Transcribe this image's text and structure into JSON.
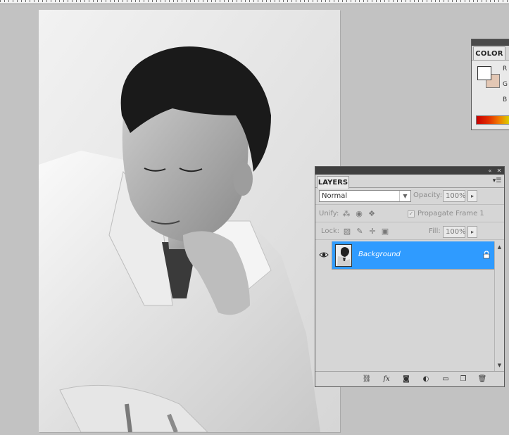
{
  "color_panel": {
    "tab_label": "COLOR",
    "channels": [
      "R",
      "G",
      "B"
    ],
    "foreground_color": "#ffffff",
    "background_color": "#e3c7b4"
  },
  "layers_panel": {
    "tab_label": "LAYERS",
    "blend_mode": "Normal",
    "opacity_label": "Opacity:",
    "opacity_value": "100%",
    "unify_label": "Unify:",
    "propagate_label": "Propagate Frame 1",
    "lock_label": "Lock:",
    "fill_label": "Fill:",
    "fill_value": "100%",
    "layers": [
      {
        "name": "Background",
        "visible": true,
        "locked": true,
        "selected": true
      }
    ],
    "selected_color": "#2f9bff"
  }
}
